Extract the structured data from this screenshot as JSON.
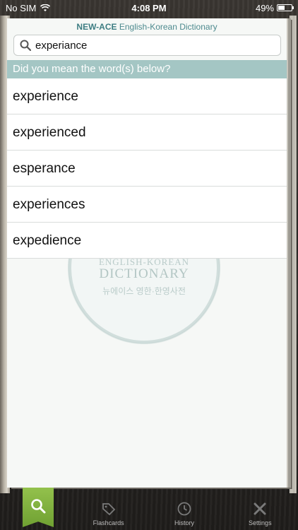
{
  "status_bar": {
    "carrier": "No SIM",
    "time": "4:08 PM",
    "battery_percent": "49%",
    "battery_level": 0.49
  },
  "app": {
    "title_brand": "NEW-ACE",
    "title_rest": "English-Korean Dictionary"
  },
  "search": {
    "value": "experiance"
  },
  "suggestions": {
    "header": "Did you mean the word(s) below?",
    "items": [
      "experience",
      "experienced",
      "esperance",
      "experiences",
      "expedience"
    ]
  },
  "seal": {
    "line1": "ENGLISH-KOREAN",
    "line2": "DICTIONARY",
    "line3": "뉴에이스 영한·한영사전"
  },
  "tabs": {
    "search": "",
    "flashcards": "Flashcards",
    "history": "History",
    "settings": "Settings"
  },
  "colors": {
    "accent": "#a4c6c4",
    "active_tab": "#7fb03e",
    "title": "#4d8a8e"
  }
}
